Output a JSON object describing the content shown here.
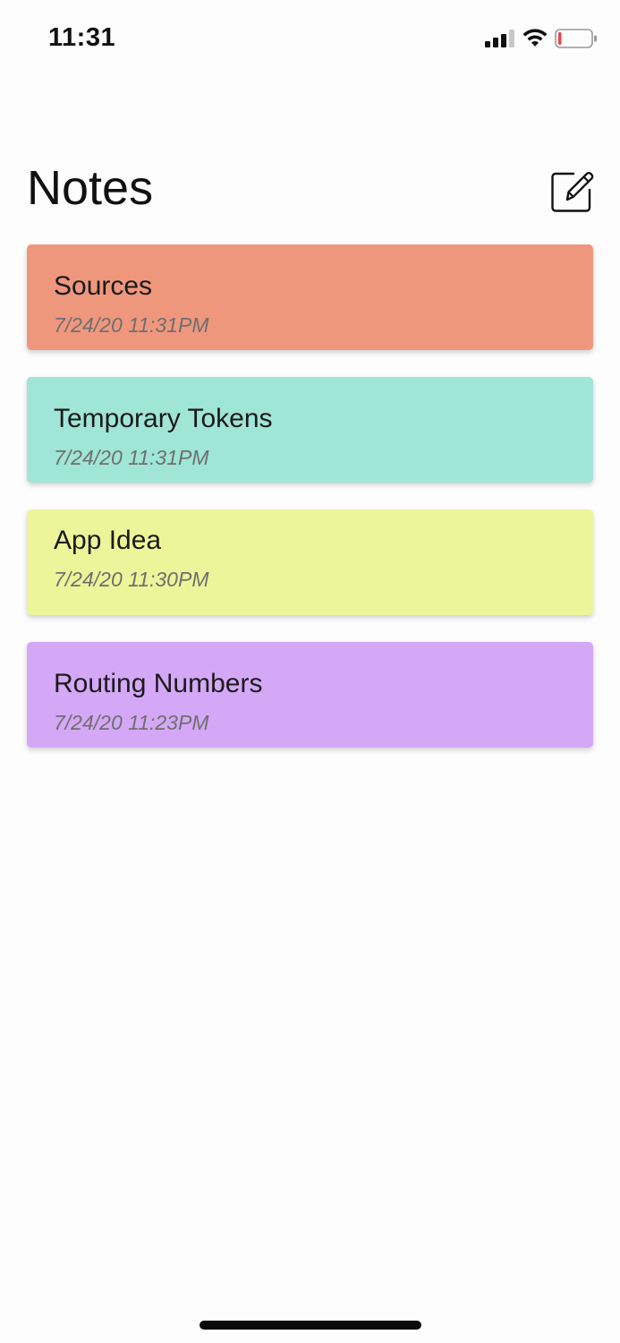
{
  "status_bar": {
    "time": "11:31",
    "icons": [
      "cellular-signal-icon",
      "wifi-icon",
      "battery-low-icon"
    ]
  },
  "header": {
    "title": "Notes",
    "compose_icon": "compose-icon"
  },
  "notes": [
    {
      "title": "Sources",
      "date": "7/24/20 11:31PM",
      "color": "#EF977D"
    },
    {
      "title": "Temporary Tokens",
      "date": "7/24/20 11:31PM",
      "color": "#9FE5D8"
    },
    {
      "title": "App Idea",
      "date": "7/24/20 11:30PM",
      "color": "#ECF59A"
    },
    {
      "title": "Routing Numbers",
      "date": "7/24/20 11:23PM",
      "color": "#D4A8F7"
    }
  ],
  "colors": {
    "background": "#FDFDFD",
    "text": "#1A1A1A",
    "date_text": "#6F6F6F",
    "battery_low": "#E5484D"
  }
}
